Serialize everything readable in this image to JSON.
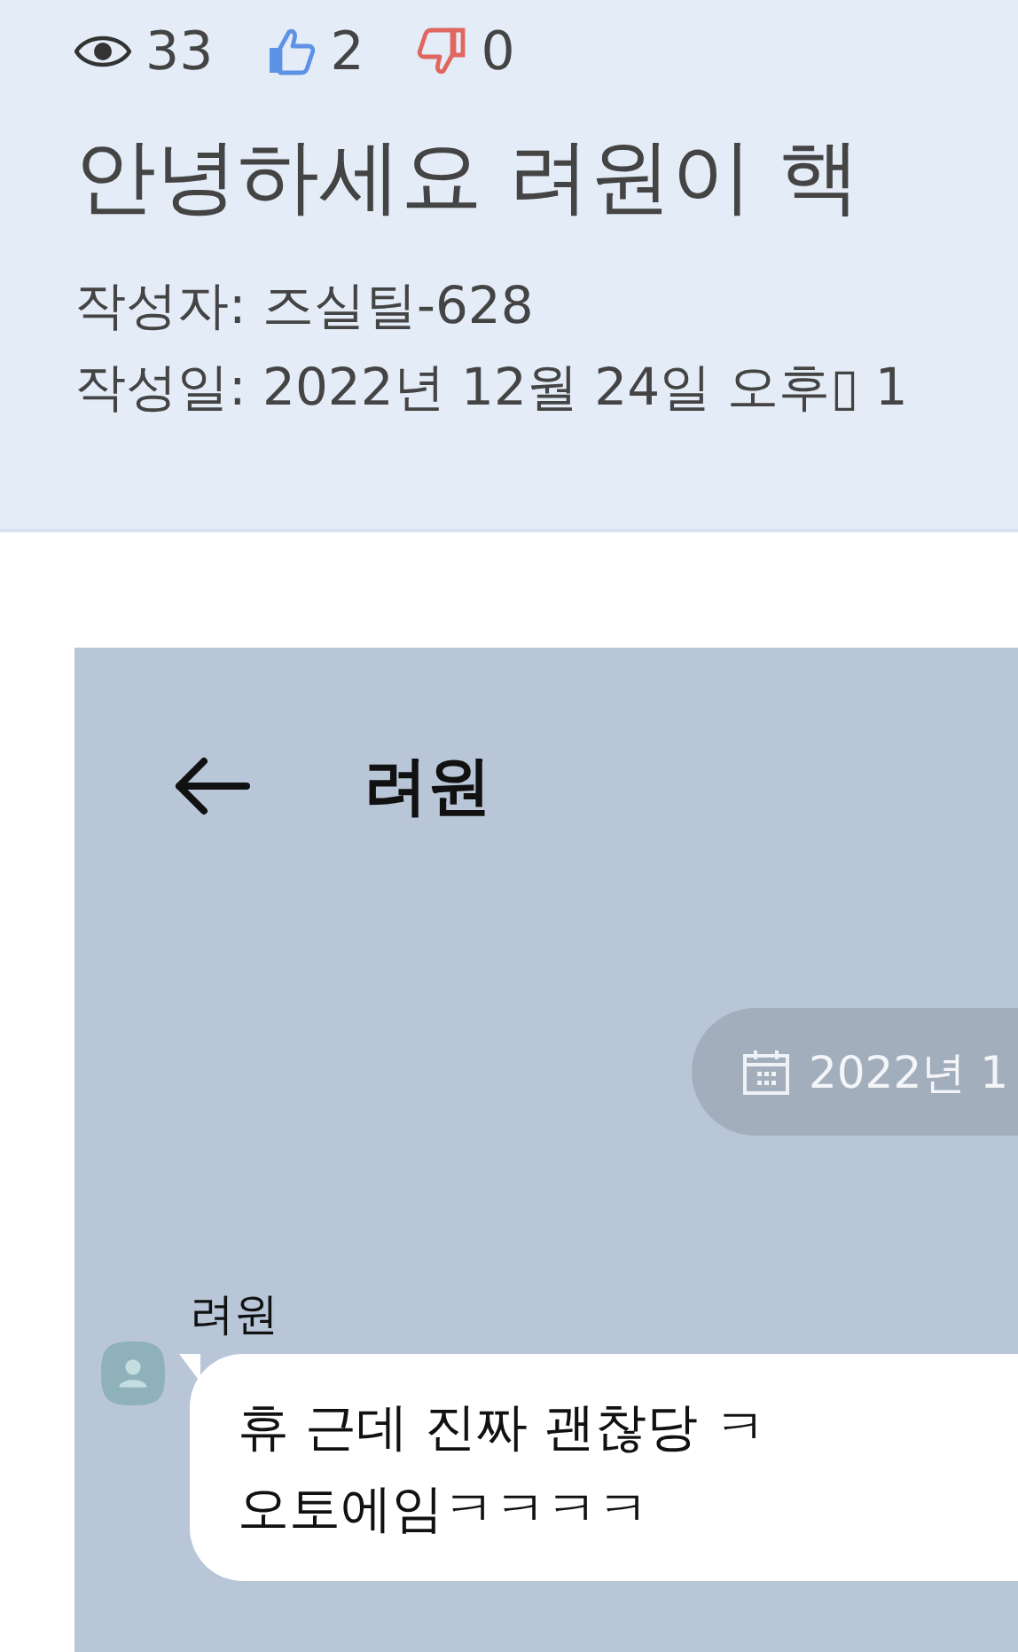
{
  "post": {
    "stats": [
      {
        "kind": "views",
        "count": "33"
      },
      {
        "kind": "likes",
        "count": "2"
      },
      {
        "kind": "dislikes",
        "count": "0"
      }
    ],
    "title": "안녕하세요 려원이 핵",
    "author": "작성자: 즈실틸-628",
    "date": "작성일: 2022년 12월 24일 오후▯ 1"
  },
  "chat": {
    "contact": "려원",
    "date_pill": "2022년 1",
    "messages": [
      {
        "sender": "려원",
        "lines": [
          "휴 근데 진짜 괜찮당 ㅋ",
          "오토에임ㅋㅋㅋㅋ"
        ]
      }
    ]
  }
}
